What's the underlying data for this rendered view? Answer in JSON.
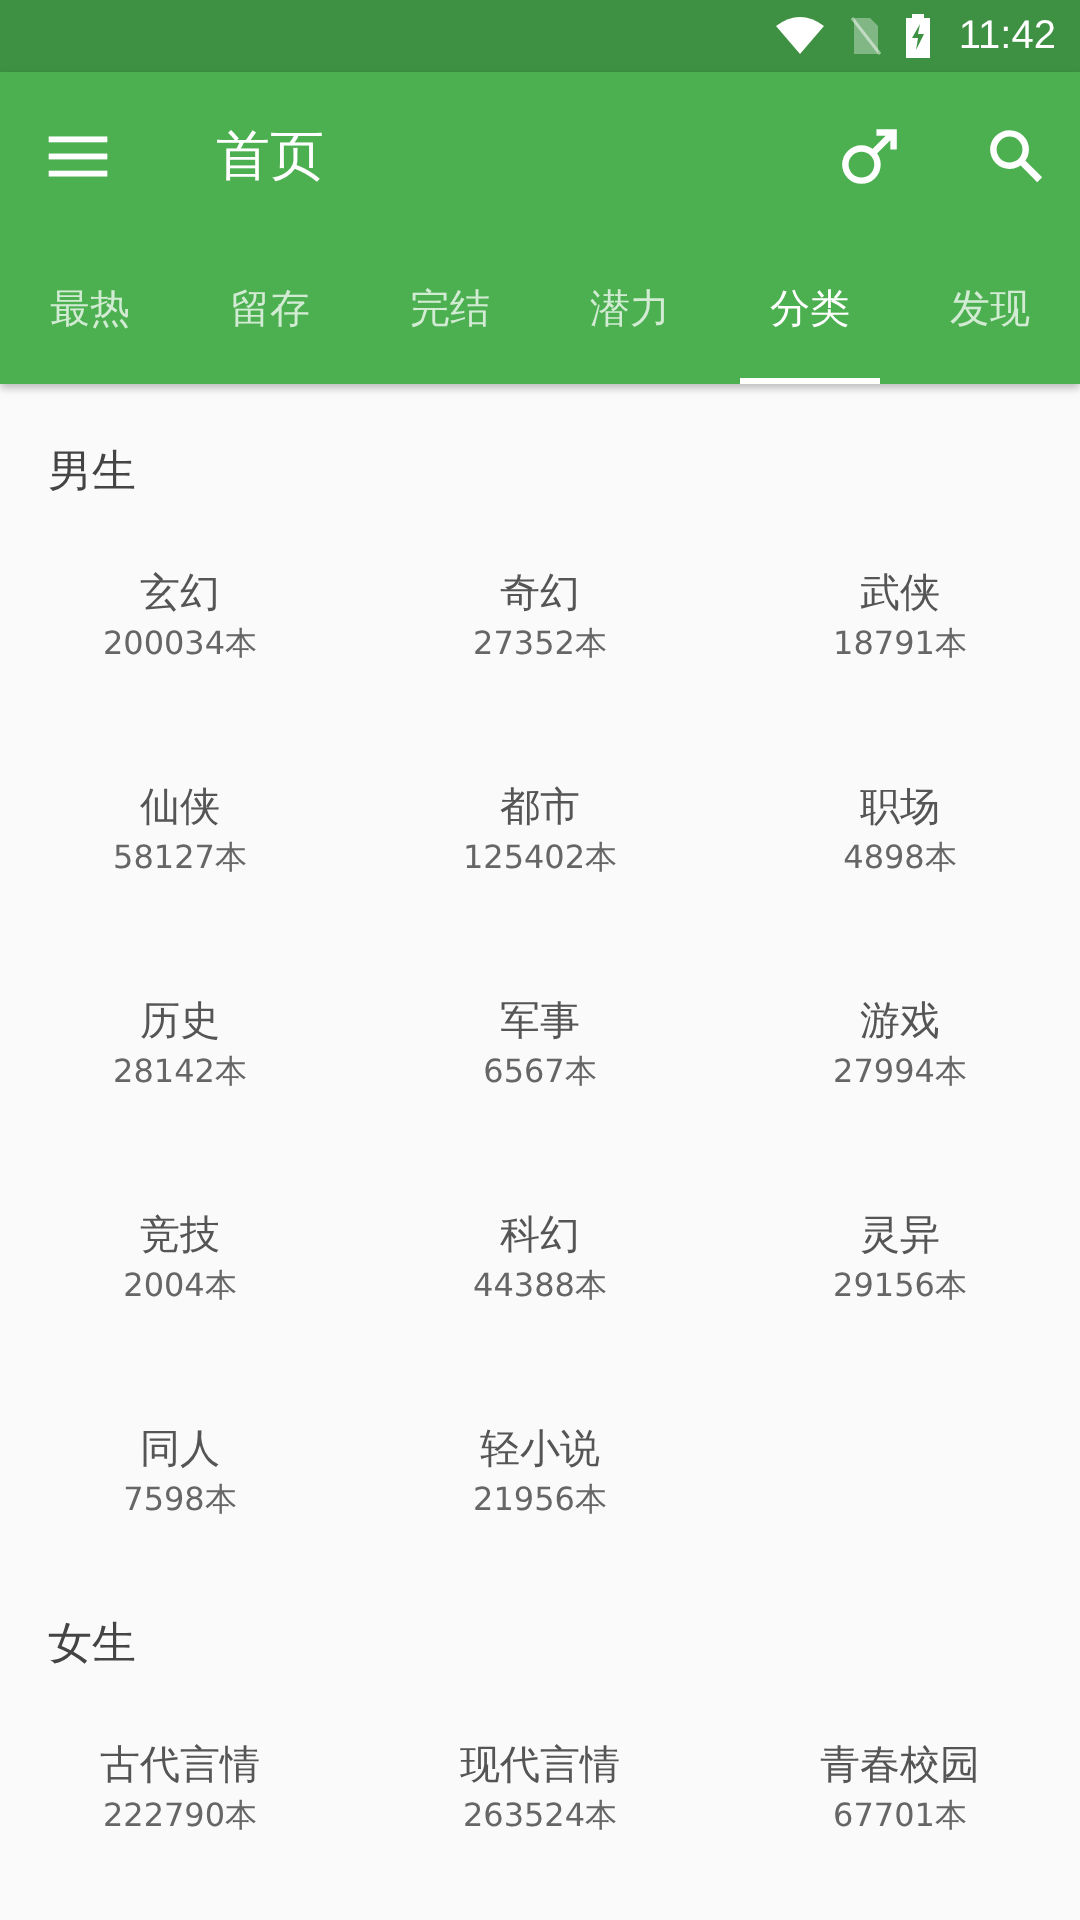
{
  "status_bar": {
    "time": "11:42"
  },
  "toolbar": {
    "title": "首页"
  },
  "tabs": [
    {
      "label": "最热",
      "selected": false
    },
    {
      "label": "留存",
      "selected": false
    },
    {
      "label": "完结",
      "selected": false
    },
    {
      "label": "潜力",
      "selected": false
    },
    {
      "label": "分类",
      "selected": true
    },
    {
      "label": "发现",
      "selected": false
    }
  ],
  "sections": [
    {
      "title": "男生",
      "items": [
        {
          "name": "玄幻",
          "count": "200034本"
        },
        {
          "name": "奇幻",
          "count": "27352本"
        },
        {
          "name": "武侠",
          "count": "18791本"
        },
        {
          "name": "仙侠",
          "count": "58127本"
        },
        {
          "name": "都市",
          "count": "125402本"
        },
        {
          "name": "职场",
          "count": "4898本"
        },
        {
          "name": "历史",
          "count": "28142本"
        },
        {
          "name": "军事",
          "count": "6567本"
        },
        {
          "name": "游戏",
          "count": "27994本"
        },
        {
          "name": "竞技",
          "count": "2004本"
        },
        {
          "name": "科幻",
          "count": "44388本"
        },
        {
          "name": "灵异",
          "count": "29156本"
        },
        {
          "name": "同人",
          "count": "7598本"
        },
        {
          "name": "轻小说",
          "count": "21956本"
        }
      ]
    },
    {
      "title": "女生",
      "items": [
        {
          "name": "古代言情",
          "count": "222790本"
        },
        {
          "name": "现代言情",
          "count": "263524本"
        },
        {
          "name": "青春校园",
          "count": "67701本"
        }
      ]
    }
  ]
}
